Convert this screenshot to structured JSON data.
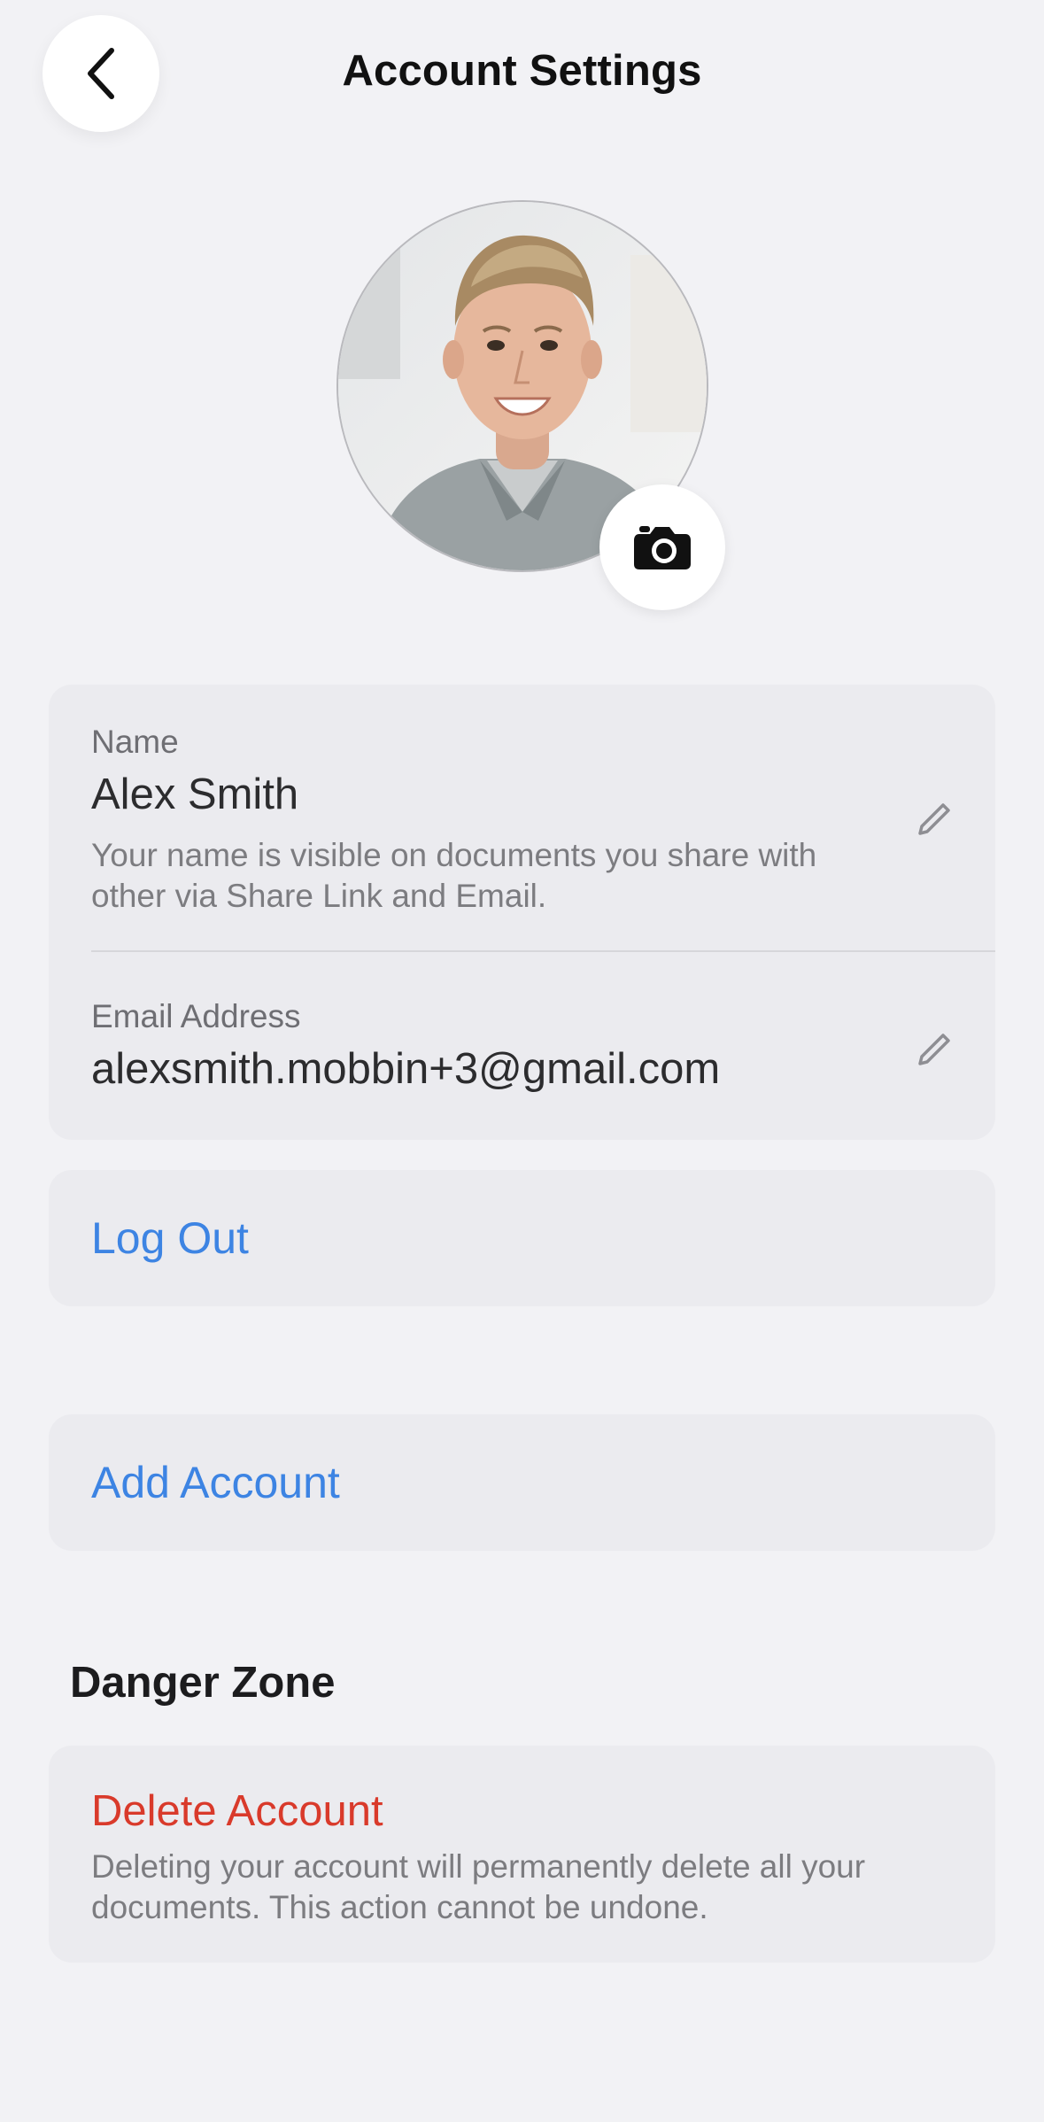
{
  "header": {
    "title": "Account Settings",
    "back_icon": "chevron-left-icon"
  },
  "profile": {
    "avatar": "profile-photo",
    "camera_icon": "camera-icon"
  },
  "account_info": {
    "name": {
      "label": "Name",
      "value": "Alex Smith",
      "help": "Your name is visible on documents you share with other via Share Link and Email.",
      "edit_icon": "pencil-icon"
    },
    "email": {
      "label": "Email Address",
      "value": "alexsmith.mobbin+3@gmail.com",
      "edit_icon": "pencil-icon"
    }
  },
  "actions": {
    "log_out": "Log Out",
    "add_account": "Add Account"
  },
  "danger_zone": {
    "title": "Danger Zone",
    "delete_label": "Delete Account",
    "delete_help": "Deleting your account will permanently delete all your documents. This action cannot be undone."
  },
  "colors": {
    "background": "#f2f2f5",
    "card": "#ebebef",
    "link_blue": "#3d84e3",
    "danger_red": "#d93a2b"
  }
}
